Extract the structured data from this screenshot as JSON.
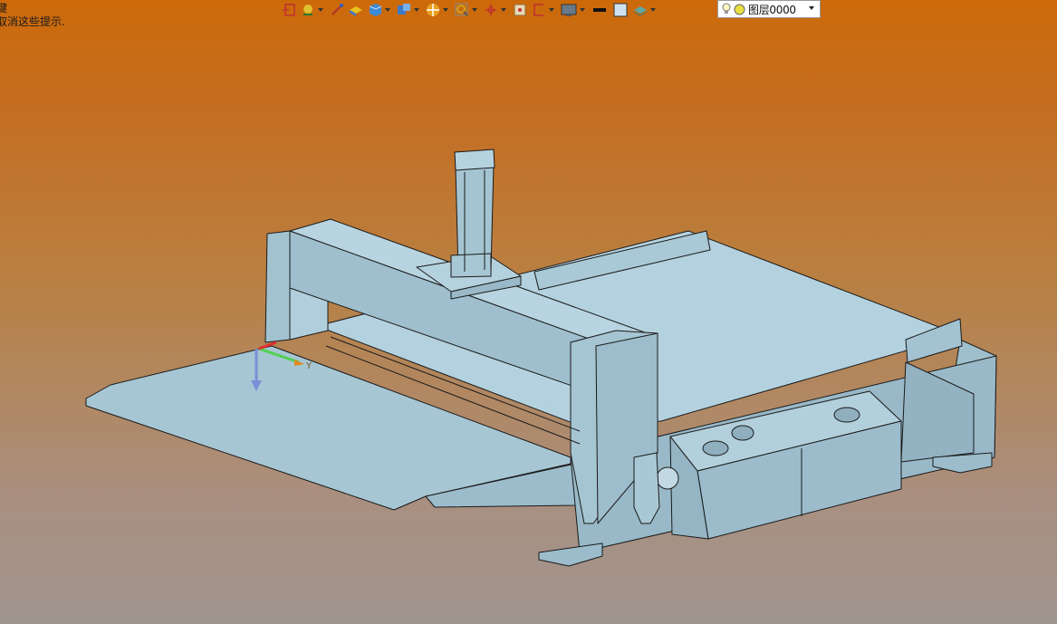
{
  "hint": {
    "line1": "键",
    "line2": "取消这些提示."
  },
  "toolbar": {
    "buttons": [
      {
        "icon": "exit-sketch-icon",
        "dropdown": false
      },
      {
        "icon": "sketch-tools-icon",
        "dropdown": true
      },
      {
        "icon": "smart-dimension-icon",
        "dropdown": false
      },
      {
        "icon": "extrude-icon",
        "dropdown": false
      },
      {
        "icon": "solid-features-icon",
        "dropdown": true
      },
      {
        "icon": "reference-geometry-icon",
        "dropdown": true
      },
      {
        "icon": "section-view-icon",
        "dropdown": true
      },
      {
        "icon": "zoom-icon",
        "dropdown": true
      },
      {
        "icon": "coordinate-triad-icon",
        "dropdown": true
      },
      {
        "icon": "view-orientation-icon",
        "dropdown": false
      },
      {
        "icon": "display-style-icon",
        "dropdown": true
      },
      {
        "icon": "monitor-display-icon",
        "dropdown": true
      },
      {
        "icon": "line-color-icon",
        "dropdown": false
      },
      {
        "icon": "face-color-icon",
        "dropdown": false
      },
      {
        "icon": "layer-properties-icon",
        "dropdown": true
      }
    ]
  },
  "layer": {
    "value": "图层0000"
  },
  "triad": {
    "y_label": "Y"
  },
  "colors": {
    "background_top": "#cc6a0a",
    "background_bottom": "#a0958f",
    "model_face": "#a8c8d8",
    "model_edge": "#1a1a1a"
  }
}
